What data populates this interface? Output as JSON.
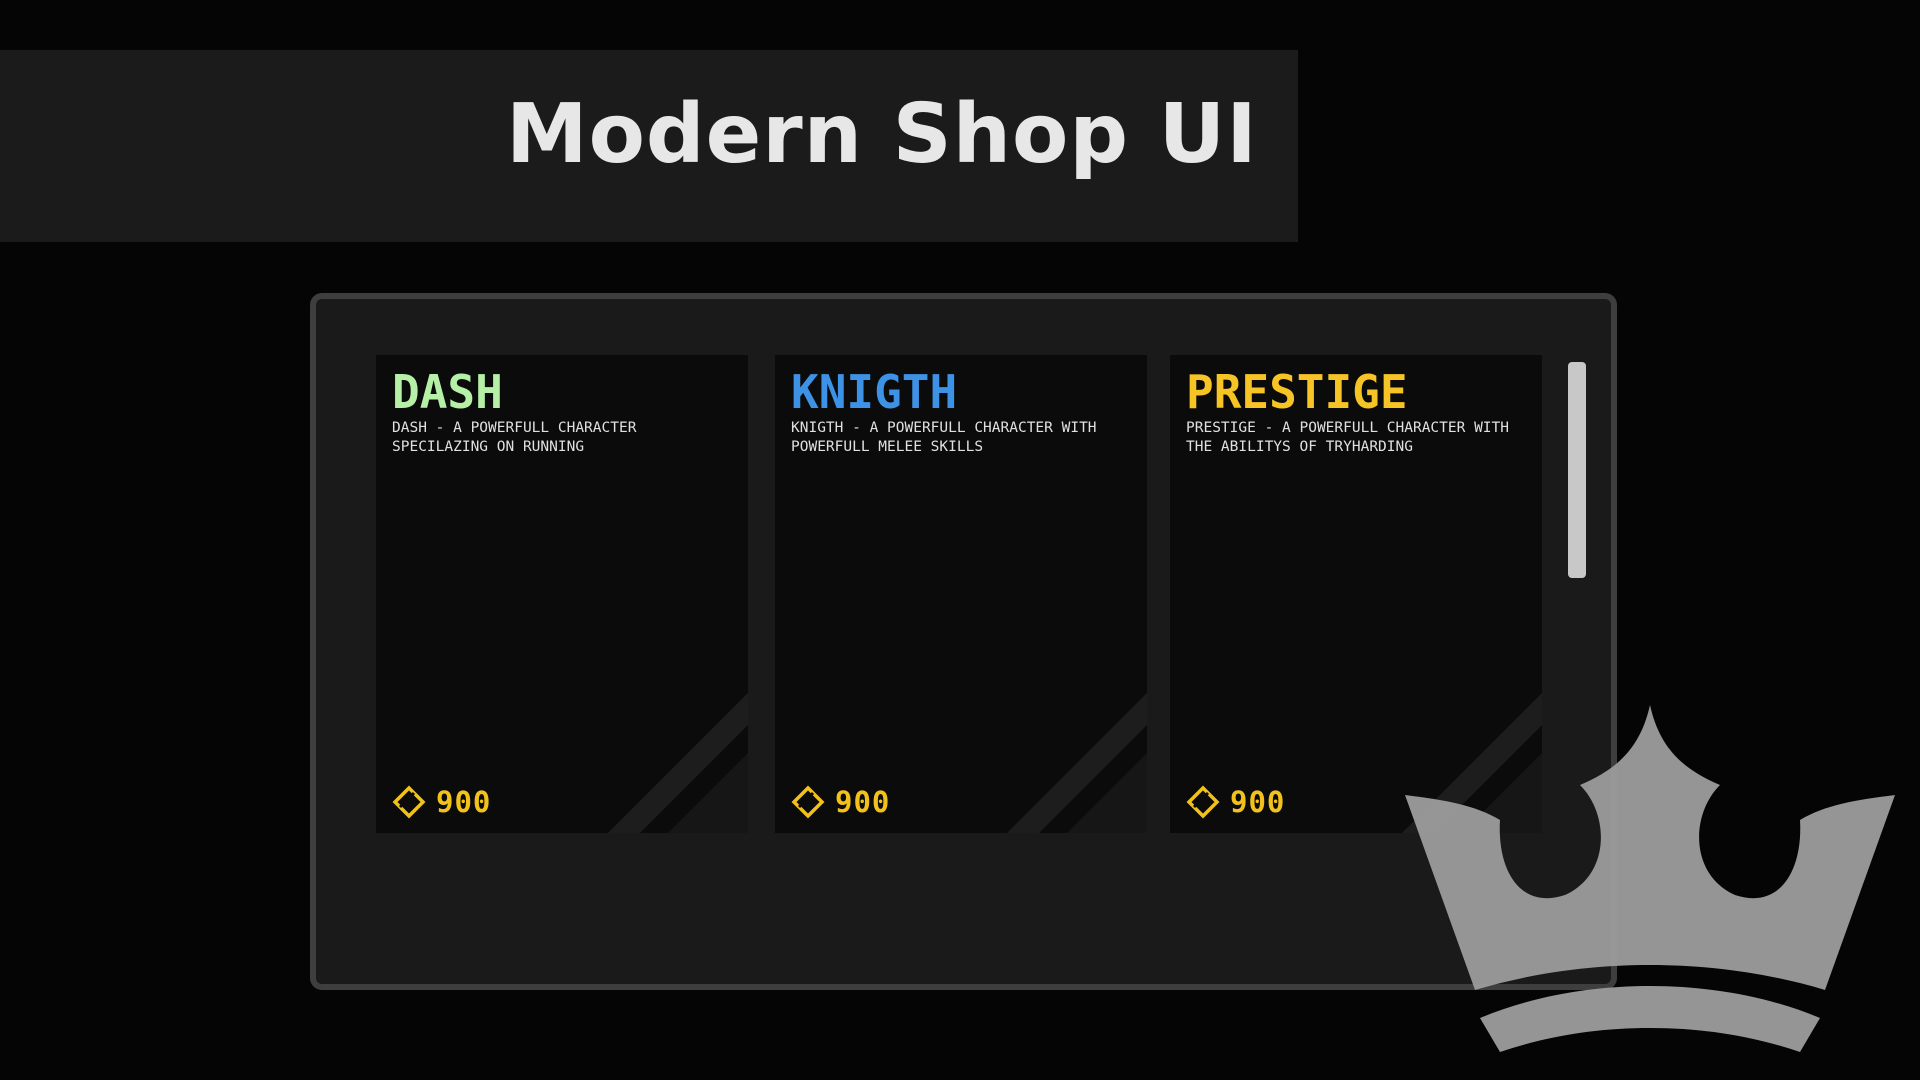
{
  "page_title": "Modern Shop UI",
  "colors": {
    "background": "#050505",
    "banner": "#1b1b1b",
    "panel": "#1a1a1a",
    "panel_border": "#3e3e3e",
    "card": "#0b0b0b",
    "currency": "#f2c21a",
    "crown_logo": "#9a9a9a"
  },
  "shop": {
    "cards": [
      {
        "name": "DASH",
        "name_color": "#b5f0a6",
        "description": "DASH - A POWERFULL CHARACTER SPECILAZING ON RUNNING",
        "price": "900",
        "currency_icon": "diamond-coin-icon"
      },
      {
        "name": "KNIGTH",
        "name_color": "#3e92e6",
        "description": "KNIGTH - A POWERFULL CHARACTER WITH POWERFULL MELEE SKILLS",
        "price": "900",
        "currency_icon": "diamond-coin-icon"
      },
      {
        "name": "PRESTIGE",
        "name_color": "#f6c525",
        "description": "PRESTIGE - A POWERFULL CHARACTER WITH THE ABILITYS OF TRYHARDING",
        "price": "900",
        "currency_icon": "diamond-coin-icon"
      }
    ]
  },
  "logo_icon": "crown-icon"
}
